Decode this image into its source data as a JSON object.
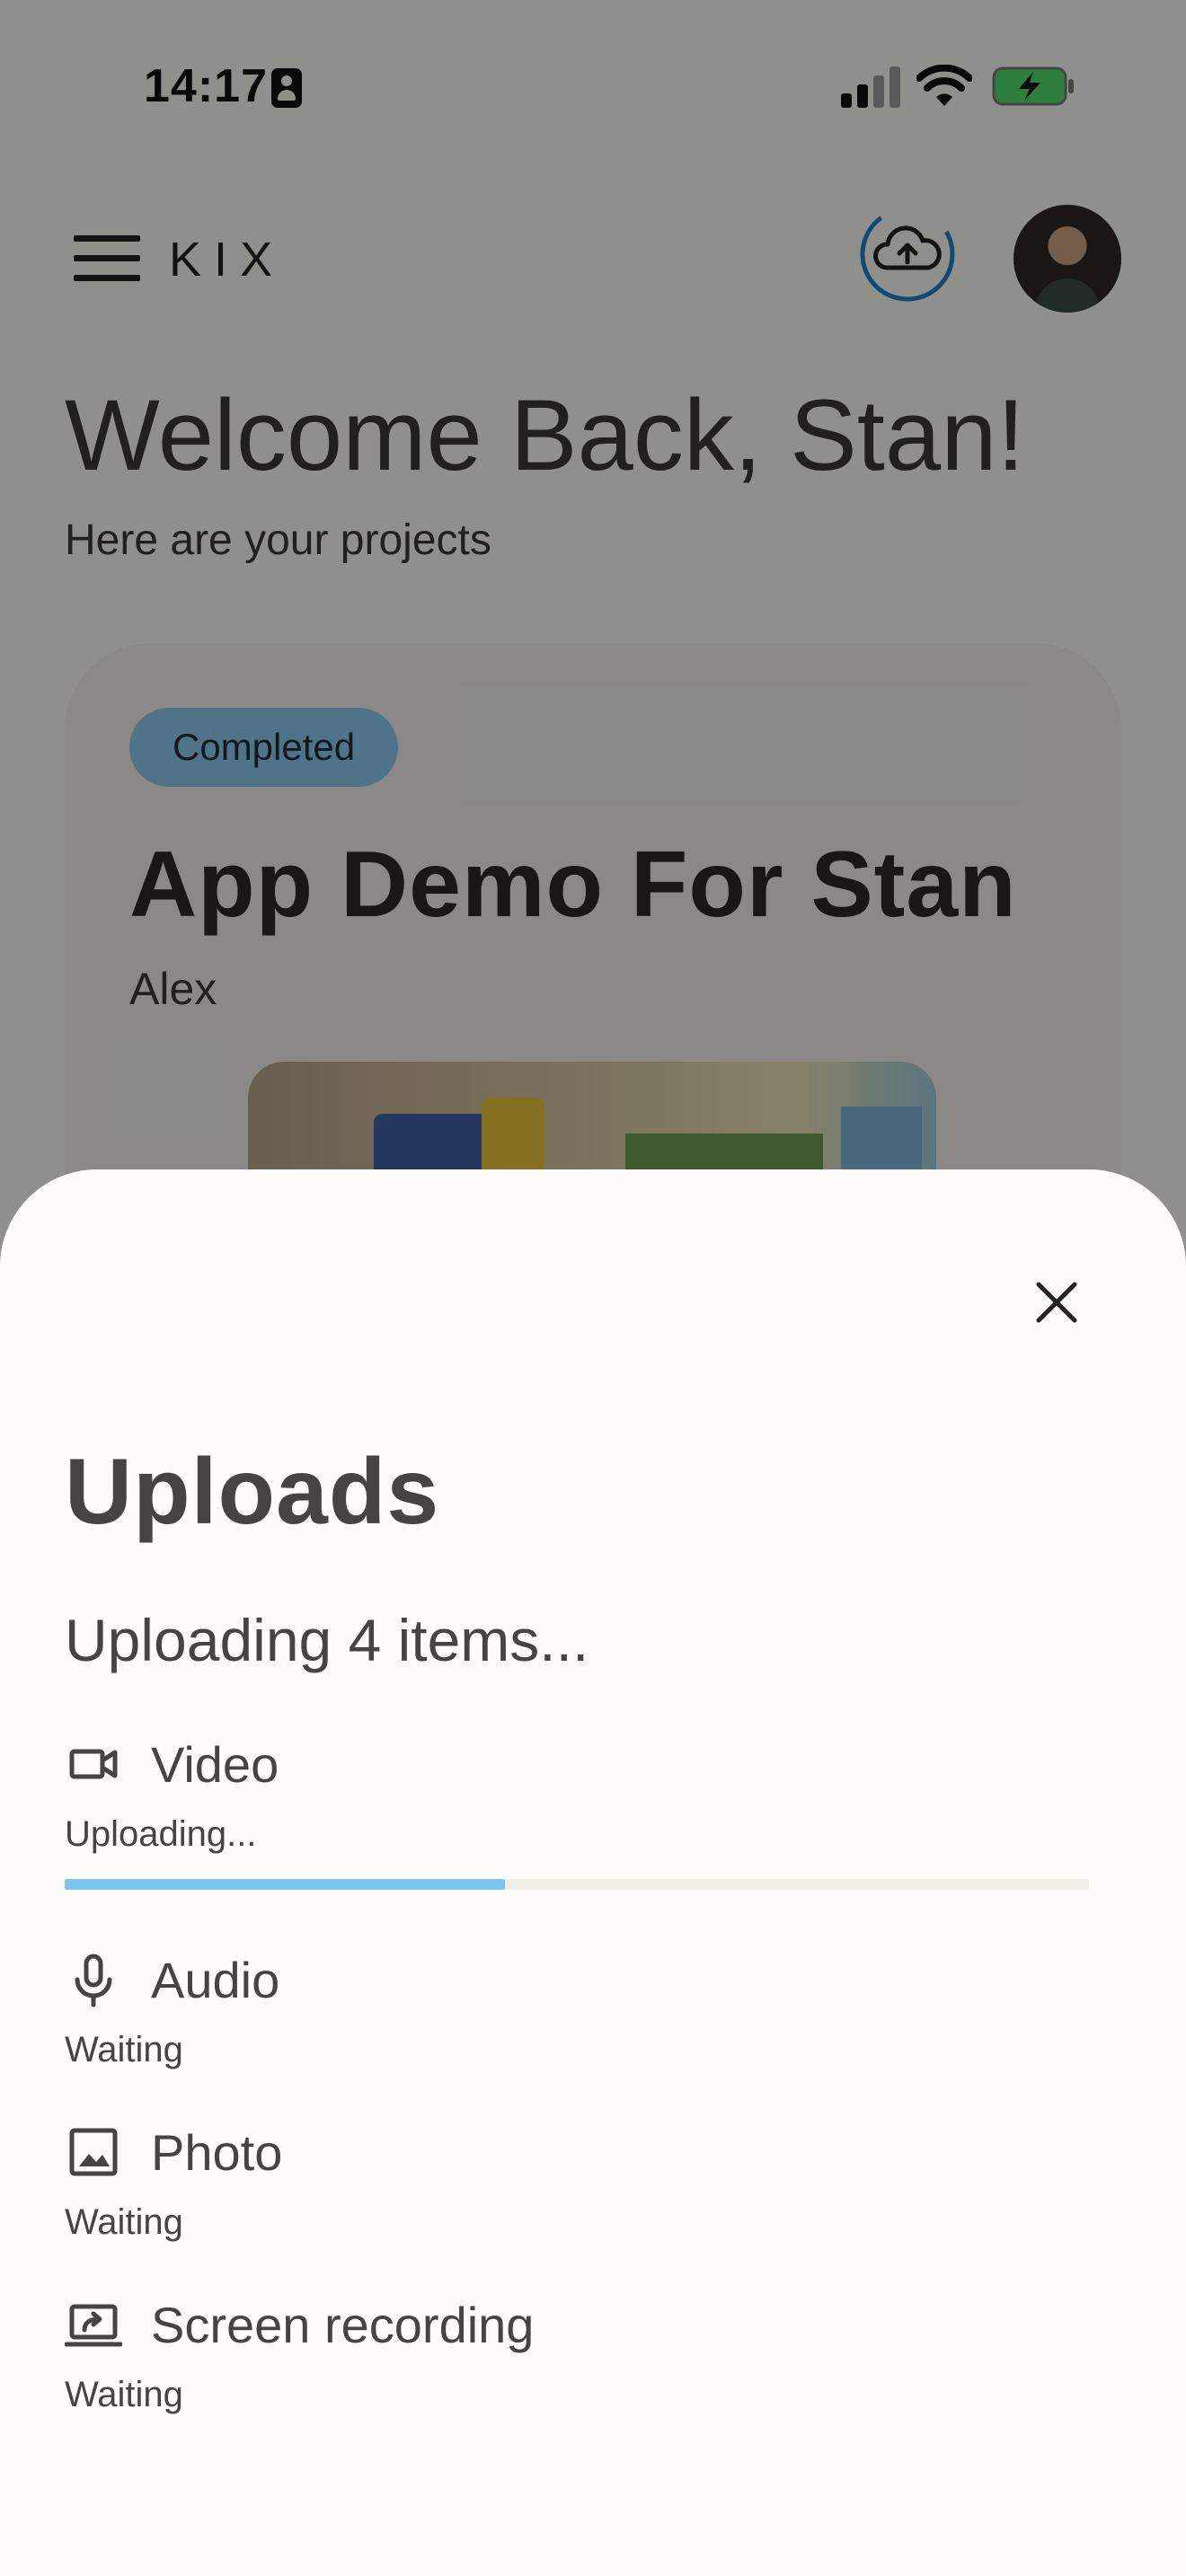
{
  "status_bar": {
    "time": "14:17",
    "battery_charging": true
  },
  "header": {
    "brand": "KIX",
    "icons": {
      "menu": "menu-icon",
      "upload": "cloud-upload-icon",
      "avatar": "avatar"
    }
  },
  "welcome": {
    "title": "Welcome Back, Stan!",
    "subtitle": "Here are your projects"
  },
  "project_card": {
    "badge": "Completed",
    "title": "App Demo For Stan",
    "author": "Alex"
  },
  "uploads_sheet": {
    "title": "Uploads",
    "summary": "Uploading 4 items...",
    "items": [
      {
        "label": "Video",
        "status": "Uploading...",
        "icon": "video-camera-icon",
        "progress": 0.43
      },
      {
        "label": "Audio",
        "status": "Waiting",
        "icon": "microphone-icon"
      },
      {
        "label": "Photo",
        "status": "Waiting",
        "icon": "image-icon"
      },
      {
        "label": "Screen recording",
        "status": "Waiting",
        "icon": "screen-share-icon"
      }
    ]
  },
  "colors": {
    "accent": "#7cc7ee",
    "badge_bg": "#88c8ea",
    "text": "#464442",
    "sheet_bg": "#fdfcfa",
    "scrim": "rgba(0,0,0,0.42)"
  }
}
